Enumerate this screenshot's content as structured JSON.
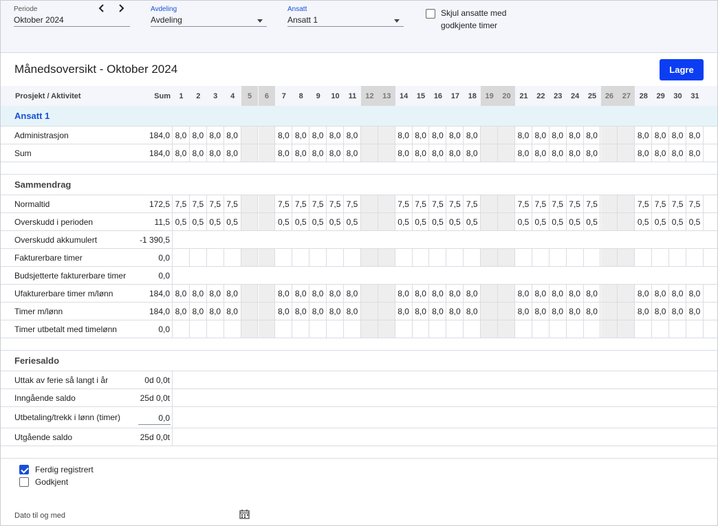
{
  "filters": {
    "period": {
      "label": "Periode",
      "value": "Oktober 2024",
      "prev_icon": "chevron-left-icon",
      "next_icon": "chevron-right-icon"
    },
    "department": {
      "label": "Avdeling",
      "value": "Avdeling"
    },
    "employee": {
      "label": "Ansatt",
      "value": "Ansatt 1"
    },
    "hide_approved": {
      "line1": "Skjul ansatte med",
      "line2": "godkjente timer",
      "checked": false
    }
  },
  "page_title": "Månedsoversikt - Oktober 2024",
  "save_label": "Lagre",
  "grid": {
    "header": {
      "label": "Prosjekt / Aktivitet",
      "sum": "Sum",
      "days": [
        "1",
        "2",
        "3",
        "4",
        "5",
        "6",
        "7",
        "8",
        "9",
        "10",
        "11",
        "12",
        "13",
        "14",
        "15",
        "16",
        "17",
        "18",
        "19",
        "20",
        "21",
        "22",
        "23",
        "24",
        "25",
        "26",
        "27",
        "28",
        "29",
        "30",
        "31"
      ],
      "weekend_days": [
        5,
        6,
        12,
        13,
        19,
        20,
        26,
        27
      ]
    },
    "employee_section": "Ansatt 1",
    "activity_rows": [
      {
        "label": "Administrasjon",
        "sum": "184,0",
        "days": [
          "8,0",
          "8,0",
          "8,0",
          "8,0",
          "",
          "",
          "8,0",
          "8,0",
          "8,0",
          "8,0",
          "8,0",
          "",
          "",
          "8,0",
          "8,0",
          "8,0",
          "8,0",
          "8,0",
          "",
          "",
          "8,0",
          "8,0",
          "8,0",
          "8,0",
          "8,0",
          "",
          "",
          "8,0",
          "8,0",
          "8,0",
          "8,0"
        ]
      },
      {
        "label": "Sum",
        "sum": "184,0",
        "days": [
          "8,0",
          "8,0",
          "8,0",
          "8,0",
          "",
          "",
          "8,0",
          "8,0",
          "8,0",
          "8,0",
          "8,0",
          "",
          "",
          "8,0",
          "8,0",
          "8,0",
          "8,0",
          "8,0",
          "",
          "",
          "8,0",
          "8,0",
          "8,0",
          "8,0",
          "8,0",
          "",
          "",
          "8,0",
          "8,0",
          "8,0",
          "8,0"
        ]
      }
    ],
    "summary_title": "Sammendrag",
    "summary_rows": [
      {
        "label": "Normaltid",
        "sum": "172,5",
        "days": [
          "7,5",
          "7,5",
          "7,5",
          "7,5",
          "",
          "",
          "7,5",
          "7,5",
          "7,5",
          "7,5",
          "7,5",
          "",
          "",
          "7,5",
          "7,5",
          "7,5",
          "7,5",
          "7,5",
          "",
          "",
          "7,5",
          "7,5",
          "7,5",
          "7,5",
          "7,5",
          "",
          "",
          "7,5",
          "7,5",
          "7,5",
          "7,5"
        ]
      },
      {
        "label": "Overskudd i perioden",
        "sum": "11,5",
        "days": [
          "0,5",
          "0,5",
          "0,5",
          "0,5",
          "",
          "",
          "0,5",
          "0,5",
          "0,5",
          "0,5",
          "0,5",
          "",
          "",
          "0,5",
          "0,5",
          "0,5",
          "0,5",
          "0,5",
          "",
          "",
          "0,5",
          "0,5",
          "0,5",
          "0,5",
          "0,5",
          "",
          "",
          "0,5",
          "0,5",
          "0,5",
          "0,5"
        ]
      },
      {
        "label": "Overskudd akkumulert",
        "sum": "-1 390,5",
        "days": null
      },
      {
        "label": "Fakturerbare timer",
        "sum": "0,0",
        "days": [
          "",
          "",
          "",
          "",
          "",
          "",
          "",
          "",
          "",
          "",
          "",
          "",
          "",
          "",
          "",
          "",
          "",
          "",
          "",
          "",
          "",
          "",
          "",
          "",
          "",
          "",
          "",
          "",
          "",
          "",
          ""
        ]
      },
      {
        "label": "Budsjetterte fakturerbare timer",
        "sum": "0,0",
        "days": null
      },
      {
        "label": "Ufakturerbare timer m/lønn",
        "sum": "184,0",
        "days": [
          "8,0",
          "8,0",
          "8,0",
          "8,0",
          "",
          "",
          "8,0",
          "8,0",
          "8,0",
          "8,0",
          "8,0",
          "",
          "",
          "8,0",
          "8,0",
          "8,0",
          "8,0",
          "8,0",
          "",
          "",
          "8,0",
          "8,0",
          "8,0",
          "8,0",
          "8,0",
          "",
          "",
          "8,0",
          "8,0",
          "8,0",
          "8,0"
        ]
      },
      {
        "label": "Timer m/lønn",
        "sum": "184,0",
        "days": [
          "8,0",
          "8,0",
          "8,0",
          "8,0",
          "",
          "",
          "8,0",
          "8,0",
          "8,0",
          "8,0",
          "8,0",
          "",
          "",
          "8,0",
          "8,0",
          "8,0",
          "8,0",
          "8,0",
          "",
          "",
          "8,0",
          "8,0",
          "8,0",
          "8,0",
          "8,0",
          "",
          "",
          "8,0",
          "8,0",
          "8,0",
          "8,0"
        ]
      },
      {
        "label": "Timer utbetalt med timelønn",
        "sum": "0,0",
        "days": [
          "",
          "",
          "",
          "",
          "",
          "",
          "",
          "",
          "",
          "",
          "",
          "",
          "",
          "",
          "",
          "",
          "",
          "",
          "",
          "",
          "",
          "",
          "",
          "",
          "",
          "",
          "",
          "",
          "",
          "",
          ""
        ]
      }
    ],
    "vacation_title": "Feriesaldo",
    "vacation_rows": [
      {
        "label": "Uttak av ferie så langt i år",
        "sum": "0d 0,0t"
      },
      {
        "label": "Inngående saldo",
        "sum": "25d 0,0t"
      },
      {
        "label": "Utbetaling/trekk i lønn (timer)",
        "sum": "0,0",
        "editable": true
      },
      {
        "label": "Utgående saldo",
        "sum": "25d 0,0t"
      }
    ]
  },
  "status": {
    "registered": {
      "label": "Ferdig registrert",
      "checked": true
    },
    "approved": {
      "label": "Godkjent",
      "checked": false
    }
  },
  "date_until": {
    "label": "Dato til og med",
    "icon": "calendar-icon"
  },
  "colors": {
    "accent": "#0b3ef2",
    "link": "#1a4fd6",
    "weekend": "#eeeeee",
    "employee_row": "#e6f4f9"
  }
}
